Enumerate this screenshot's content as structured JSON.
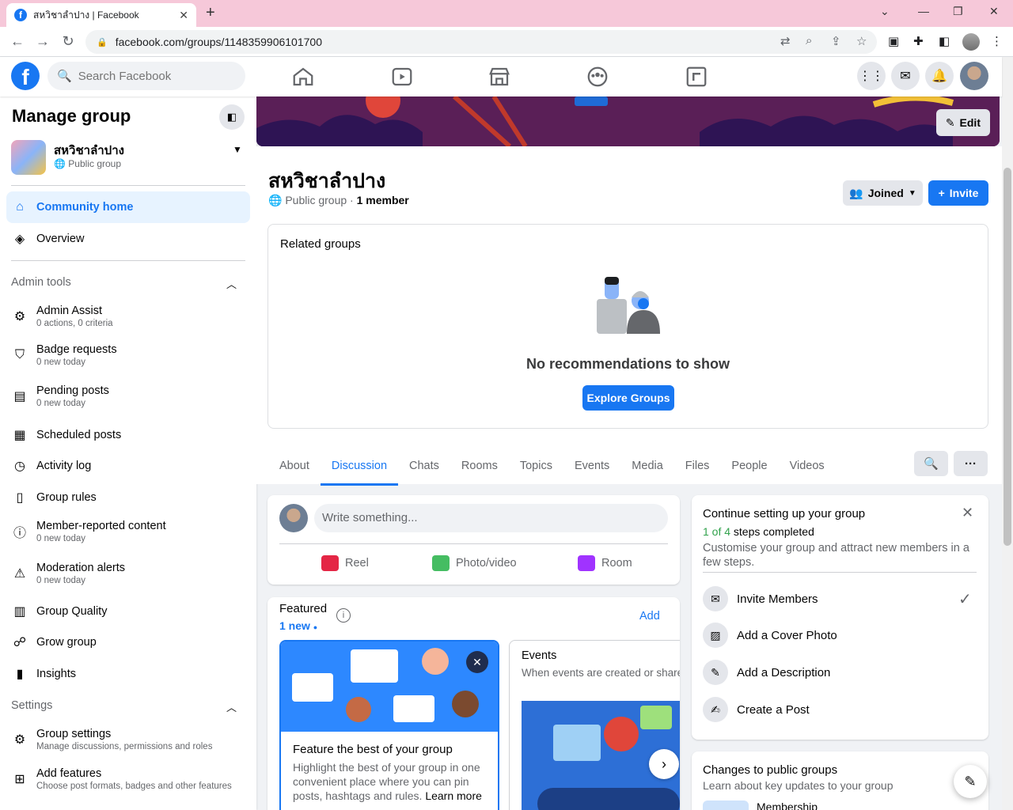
{
  "browser": {
    "tab_title": "สหวิชาลำปาง | Facebook",
    "url": "facebook.com/groups/1148359906101700"
  },
  "fbnav": {
    "search_placeholder": "Search Facebook"
  },
  "sidebar": {
    "title": "Manage group",
    "group_name": "สหวิชาลำปาง",
    "group_privacy": "Public group",
    "nav": [
      {
        "label": "Community home",
        "active": true
      },
      {
        "label": "Overview",
        "active": false
      }
    ],
    "admin_tools_label": "Admin tools",
    "admin_tools": [
      {
        "label": "Admin Assist",
        "sub": "0 actions, 0 criteria"
      },
      {
        "label": "Badge requests",
        "sub": "0 new today"
      },
      {
        "label": "Pending posts",
        "sub": "0 new today"
      },
      {
        "label": "Scheduled posts",
        "sub": ""
      },
      {
        "label": "Activity log",
        "sub": ""
      },
      {
        "label": "Group rules",
        "sub": ""
      },
      {
        "label": "Member-reported content",
        "sub": "0 new today"
      },
      {
        "label": "Moderation alerts",
        "sub": "0 new today"
      },
      {
        "label": "Group Quality",
        "sub": ""
      },
      {
        "label": "Grow group",
        "sub": ""
      },
      {
        "label": "Insights",
        "sub": ""
      }
    ],
    "settings_label": "Settings",
    "settings": [
      {
        "label": "Group settings",
        "sub": "Manage discussions, permissions and roles"
      },
      {
        "label": "Add features",
        "sub": "Choose post formats, badges and other features"
      }
    ]
  },
  "header": {
    "edit_label": "Edit",
    "group_name": "สหวิชาลำปาง",
    "privacy": "Public group",
    "members": "1 member",
    "joined_label": "Joined",
    "invite_label": "Invite"
  },
  "related": {
    "title": "Related groups",
    "empty_text": "No recommendations to show",
    "explore_label": "Explore Groups"
  },
  "tabs": [
    "About",
    "Discussion",
    "Chats",
    "Rooms",
    "Topics",
    "Events",
    "Media",
    "Files",
    "People",
    "Videos"
  ],
  "active_tab": "Discussion",
  "composer": {
    "placeholder": "Write something...",
    "reel_label": "Reel",
    "photo_label": "Photo/video",
    "room_label": "Room"
  },
  "featured": {
    "title": "Featured",
    "new_label": "1 new",
    "add_label": "Add",
    "card1_title": "Feature the best of your group",
    "card1_text": "Highlight the best of your group in one convenient place where you can pin posts, hashtags and rules.",
    "card1_link": "Learn more",
    "card2_title": "Events",
    "card2_text": "When events are created or shared, they appear on this card."
  },
  "setup": {
    "title": "Continue setting up your group",
    "steps_done": "1 of 4",
    "steps_suffix": "steps completed",
    "description": "Customise your group and attract new members in a few steps.",
    "steps": [
      {
        "label": "Invite Members",
        "done": true
      },
      {
        "label": "Add a Cover Photo",
        "done": false
      },
      {
        "label": "Add a Description",
        "done": false
      },
      {
        "label": "Create a Post",
        "done": false
      }
    ]
  },
  "changes": {
    "title": "Changes to public groups",
    "subtitle": "Learn about key updates to your group",
    "item": "Membership"
  },
  "colors": {
    "fb_blue": "#1877f2",
    "tabbar_pink": "#f6c8d9",
    "success_green": "#31a24c",
    "cover_purple": "#5a1f57"
  }
}
